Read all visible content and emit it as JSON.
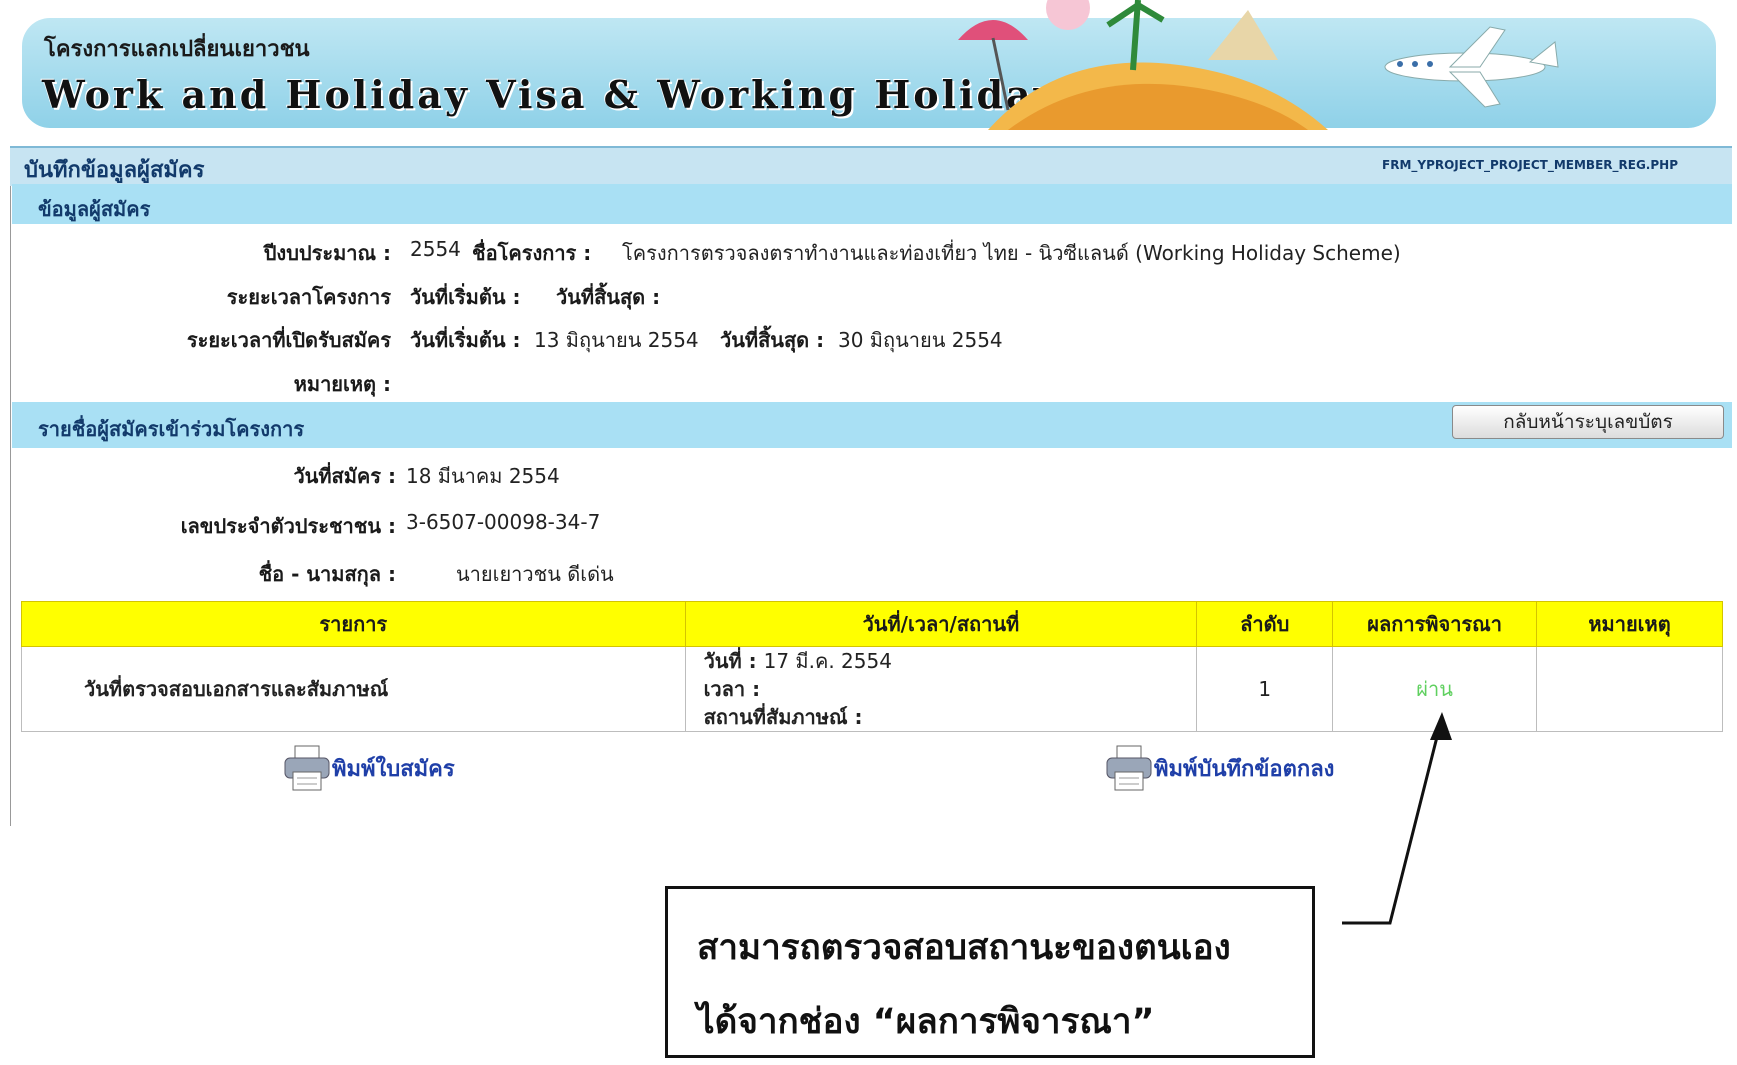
{
  "banner": {
    "subtitle": "โครงการแลกเปลี่ยนเยาวชน",
    "title": "Work and Holiday Visa & Working Holiday Scheme"
  },
  "page": {
    "title": "บันทึกข้อมูลผู้สมัคร",
    "form_code": "FRM_YPROJECT_PROJECT_MEMBER_REG.PHP"
  },
  "applicant_info": {
    "heading": "ข้อมูลผู้สมัคร",
    "fiscal_year_label": "ปีงบประมาณ :",
    "fiscal_year": "2554",
    "project_name_label": "ชื่อโครงการ :",
    "project_name": "โครงการตรวจลงตราทำงานและท่องเที่ยว ไทย - นิวซีแลนด์ (Working Holiday Scheme)",
    "project_period_label": "ระยะเวลาโครงการ",
    "start_label": "วันที่เริ่มต้น :",
    "end_label": "วันที่สิ้นสุด :",
    "registration_period_label": "ระยะเวลาที่เปิดรับสมัคร",
    "reg_start_label": "วันที่เริ่มต้น :",
    "reg_start": "13 มิถุนายน 2554",
    "reg_end_label": "วันที่สิ้นสุด :",
    "reg_end": "30 มิถุนายน 2554",
    "remark_label": "หมายเหตุ :"
  },
  "participants": {
    "heading": "รายชื่อผู้สมัครเข้าร่วมโครงการ",
    "back_button": "กลับหน้าระบุเลขบัตร",
    "apply_date_label": "วันที่สมัคร :",
    "apply_date": "18 มีนาคม 2554",
    "citizen_id_label": "เลขประจำตัวประชาชน :",
    "citizen_id": "3-6507-00098-34-7",
    "name_label": "ชื่อ - นามสกุล :",
    "name": "นายเยาวชน ดีเด่น"
  },
  "table": {
    "headers": [
      "รายการ",
      "วันที่/เวลา/สถานที่",
      "ลำดับ",
      "ผลการพิจารณา",
      "หมายเหตุ"
    ],
    "rows": [
      {
        "item": "วันที่ตรวจสอบเอกสารและสัมภาษณ์",
        "date_label": "วันที่ :",
        "date": "17 มี.ค. 2554",
        "time_label": "เวลา :",
        "place_label": "สถานที่สัมภาษณ์ :",
        "order": "1",
        "result": "ผ่าน",
        "remark": ""
      }
    ]
  },
  "actions": {
    "print_application": "พิมพ์ใบสมัคร",
    "print_agreement": "พิมพ์บันทึกข้อตกลง"
  },
  "callout": {
    "line1": "สามารถตรวจสอบสถานะของตนเอง",
    "line2": "ได้จากช่อง “ผลการพิจารณา”"
  },
  "colors": {
    "banner": "#8fd1e8",
    "section_head": "#c7e4f2",
    "subhead": "#a9e0f4",
    "table_header": "#ffff00",
    "pass": "#5fd05f",
    "link": "#1f3fa8"
  }
}
